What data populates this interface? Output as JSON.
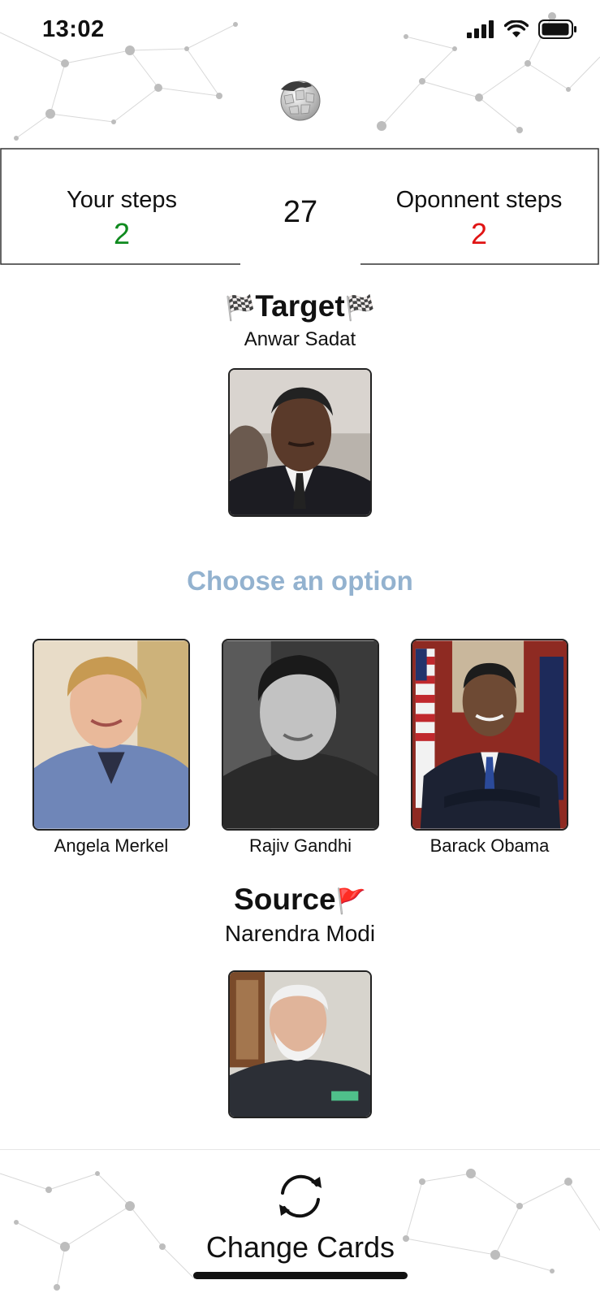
{
  "status_bar": {
    "time": "13:02"
  },
  "scoreboard": {
    "your_steps_label": "Your steps",
    "your_steps_value": "2",
    "counter": "27",
    "opponent_steps_label": "Oponnent steps",
    "opponent_steps_value": "2"
  },
  "target": {
    "title": "Target",
    "flag_icon": "🏁",
    "name": "Anwar Sadat"
  },
  "choose_prompt": "Choose an option",
  "options": [
    {
      "name": "Angela Merkel"
    },
    {
      "name": "Rajiv Gandhi"
    },
    {
      "name": "Barack Obama"
    }
  ],
  "source": {
    "title": "Source",
    "flag_icon": "🚩",
    "name": "Narendra Modi"
  },
  "change_cards": {
    "label": "Change Cards",
    "icon": "refresh-icon"
  },
  "colors": {
    "your_steps": "#0f8a1e",
    "opponent_steps": "#e01414",
    "prompt": "#93b2cf"
  }
}
